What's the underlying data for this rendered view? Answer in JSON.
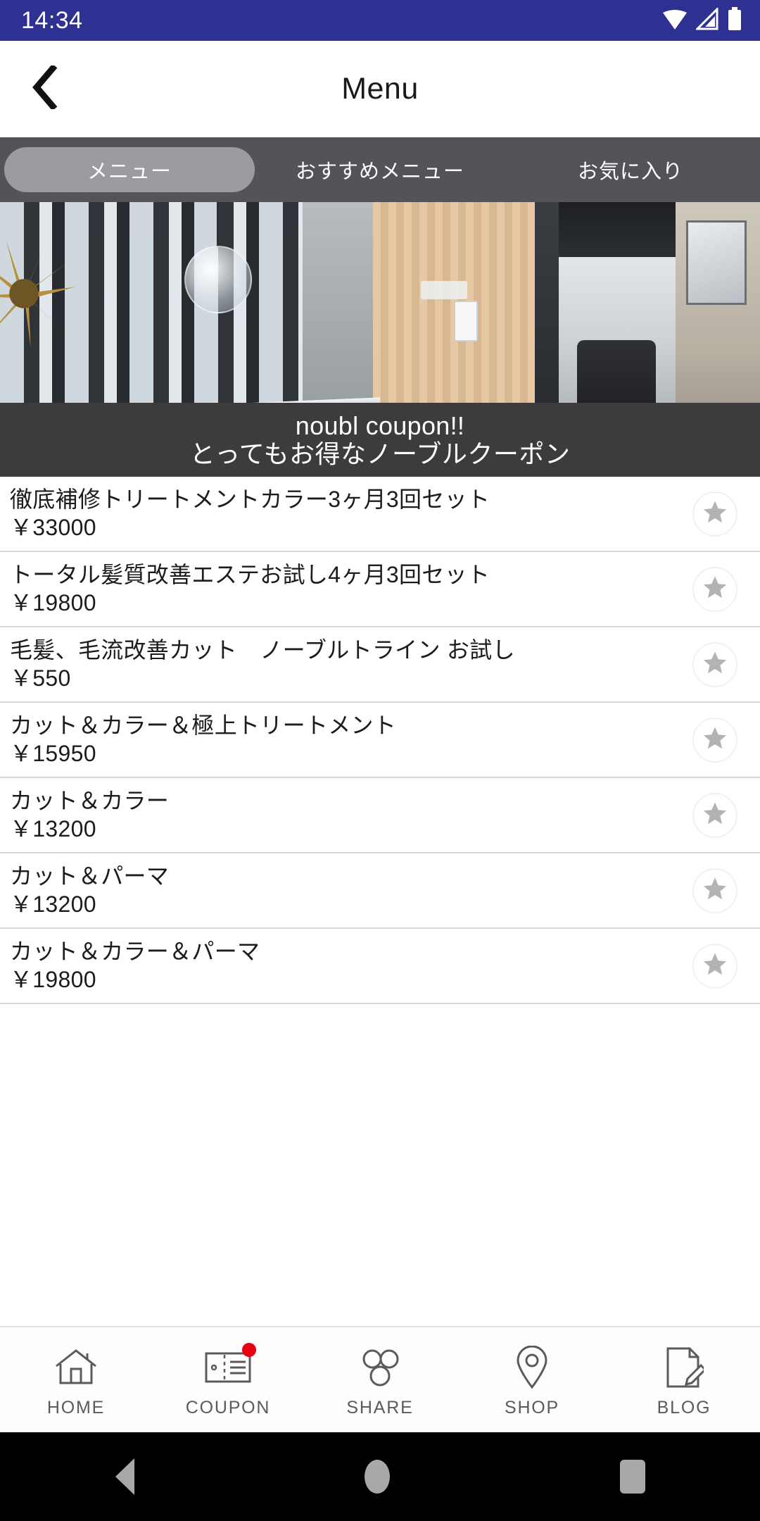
{
  "status_bar": {
    "clock": "14:34",
    "icons": [
      "wifi-icon",
      "signal-icon",
      "battery-icon"
    ]
  },
  "header": {
    "back_icon": "chevron-left-icon",
    "title": "Menu"
  },
  "tabs": [
    {
      "label": "メニュー",
      "active": true
    },
    {
      "label": "おすすめメニュー",
      "active": false
    },
    {
      "label": "お気に入り",
      "active": false
    }
  ],
  "banner": {
    "alt": "salon-interior-photo",
    "caption_en": "noubl coupon!!",
    "caption_jp": "とってもお得なノーブルクーポン"
  },
  "menu_items": [
    {
      "title": "徹底補修トリートメントカラー3ヶ月3回セット",
      "price": "￥33000",
      "favorite_icon": "star-icon"
    },
    {
      "title": "トータル髪質改善エステお試し4ヶ月3回セット",
      "price": "￥19800",
      "favorite_icon": "star-icon"
    },
    {
      "title": "毛髪、毛流改善カット　ノーブルトライン お試し",
      "price": "￥550",
      "favorite_icon": "star-icon"
    },
    {
      "title": "カット＆カラー＆極上トリートメント",
      "price": "￥15950",
      "favorite_icon": "star-icon"
    },
    {
      "title": "カット＆カラー",
      "price": "￥13200",
      "favorite_icon": "star-icon"
    },
    {
      "title": "カット＆パーマ",
      "price": "￥13200",
      "favorite_icon": "star-icon"
    },
    {
      "title": "カット＆カラー＆パーマ",
      "price": "￥19800",
      "favorite_icon": "star-icon"
    }
  ],
  "bottom_nav": [
    {
      "label": "HOME",
      "icon": "home-icon",
      "badge": false
    },
    {
      "label": "COUPON",
      "icon": "ticket-icon",
      "badge": true
    },
    {
      "label": "SHARE",
      "icon": "share-nodes-icon",
      "badge": false
    },
    {
      "label": "SHOP",
      "icon": "map-pin-icon",
      "badge": false
    },
    {
      "label": "BLOG",
      "icon": "document-pencil-icon",
      "badge": false
    }
  ],
  "system_nav": [
    {
      "icon": "android-back-icon"
    },
    {
      "icon": "android-home-icon"
    },
    {
      "icon": "android-recents-icon"
    }
  ],
  "colors": {
    "status_bar": "#2e3192",
    "tab_bar": "#565358",
    "tab_active": "#9d9aa0",
    "caption_bar": "#3d3b3c",
    "badge_red": "#e60012",
    "star_gray": "#b3b3b3",
    "text_primary": "#1c1c1c"
  }
}
